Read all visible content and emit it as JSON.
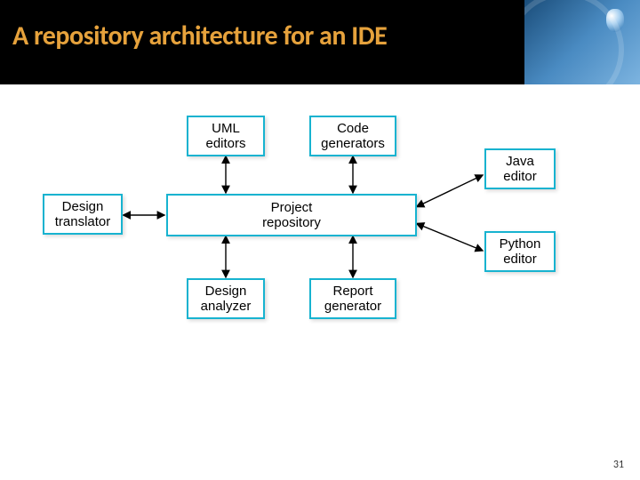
{
  "title": "A repository architecture for an IDE",
  "page_number": "31",
  "boxes": {
    "uml_editors": "UML\neditors",
    "code_generators": "Code\ngenerators",
    "java_editor": "Java\neditor",
    "design_translator": "Design\ntranslator",
    "project_repository": "Project\nrepository",
    "python_editor": "Python\neditor",
    "design_analyzer": "Design\nanalyzer",
    "report_generator": "Report\ngenerator"
  }
}
